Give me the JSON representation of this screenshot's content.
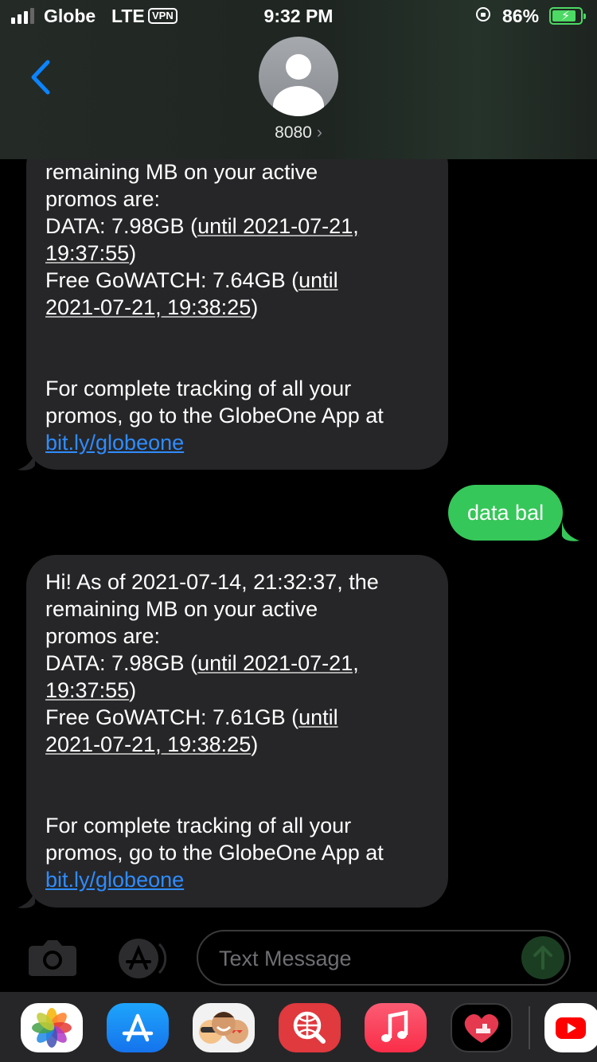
{
  "status_bar": {
    "carrier": "Globe",
    "network": "LTE",
    "vpn_label": "VPN",
    "time": "9:32 PM",
    "battery_percent": "86%",
    "battery_level": 0.86,
    "signal_bars": 3
  },
  "header": {
    "contact_name": "8080",
    "contact_chevron": "›"
  },
  "messages": [
    {
      "direction": "incoming",
      "segments": [
        {
          "text": "remaining MB on your active\npromos are:\nDATA: 7.98GB ("
        },
        {
          "text": "until 2021-07-21,\n19:37:55",
          "style": "underline"
        },
        {
          "text": ")\nFree GoWATCH: 7.64GB ("
        },
        {
          "text": "until\n2021-07-21, 19:38:25",
          "style": "underline"
        },
        {
          "text": ")\n\n\nFor complete tracking of all your\npromos, go to the GlobeOne App at\n"
        },
        {
          "text": "bit.ly/globeone",
          "style": "link"
        }
      ]
    },
    {
      "direction": "outgoing",
      "text": "data bal"
    },
    {
      "direction": "incoming",
      "segments": [
        {
          "text": "Hi! As of 2021-07-14, 21:32:37, the\nremaining MB on your active\npromos are:\nDATA: 7.98GB ("
        },
        {
          "text": "until 2021-07-21,\n19:37:55",
          "style": "underline"
        },
        {
          "text": ")\nFree GoWATCH: 7.61GB ("
        },
        {
          "text": "until\n2021-07-21, 19:38:25",
          "style": "underline"
        },
        {
          "text": ")\n\n\nFor complete tracking of all your\npromos, go to the GlobeOne App at\n"
        },
        {
          "text": "bit.ly/globeone",
          "style": "link"
        }
      ]
    }
  ],
  "input_bar": {
    "placeholder": "Text Message"
  },
  "app_drawer": {
    "apps": [
      "photos-icon",
      "app-store-icon",
      "memoji-icon",
      "web-search-icon",
      "music-icon",
      "heart-sticker-icon",
      "youtube-icon"
    ]
  },
  "colors": {
    "incoming_bubble": "#262628",
    "outgoing_bubble": "#35c759",
    "link": "#2f8cff",
    "accent": "#0a84ff",
    "battery": "#4cd964"
  }
}
